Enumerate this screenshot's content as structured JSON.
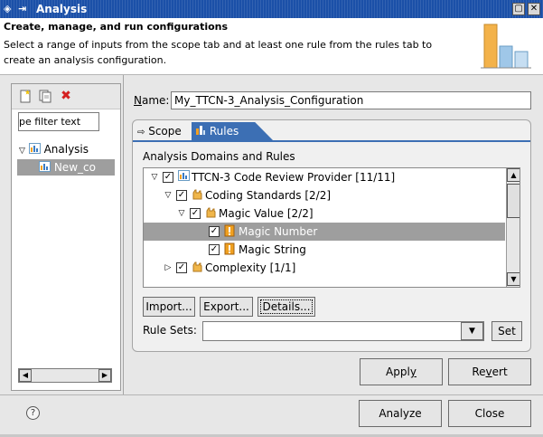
{
  "window": {
    "title": "Analysis",
    "title_arrow": "⇥",
    "title_icon": "analysis-window-icon",
    "buttons": [
      "maximize",
      "close"
    ]
  },
  "header": {
    "title": "Create, manage, and run configurations",
    "description": "Select a range of inputs from the scope tab and at least one rule from the rules tab to create an analysis configuration."
  },
  "left_panel": {
    "filter_text": "pe filter text",
    "tree": {
      "root_label": "Analysis",
      "child_label": "New_co"
    },
    "toolbar_icons": [
      "new-configuration-icon",
      "duplicate-icon",
      "delete-icon"
    ]
  },
  "name_field": {
    "label_prefix": "N",
    "label_rest": "ame:",
    "value": "My_TTCN-3_Analysis_Configuration"
  },
  "tabs": {
    "scope": "Scope",
    "rules": "Rules",
    "active": "Rules"
  },
  "rules_tab": {
    "section_label": "Analysis Domains and Rules",
    "tree_rows": [
      {
        "label": "TTCN-3 Code Review Provider [11/11]",
        "level": 0,
        "expanded": true,
        "checked": true,
        "icon": "provider-icon",
        "selected": false
      },
      {
        "label": "Coding Standards [2/2]",
        "level": 1,
        "expanded": true,
        "checked": true,
        "icon": "category-icon",
        "selected": false
      },
      {
        "label": "Magic Value [2/2]",
        "level": 2,
        "expanded": true,
        "checked": true,
        "icon": "category-icon",
        "selected": false
      },
      {
        "label": "Magic Number",
        "level": 3,
        "expanded": null,
        "checked": true,
        "icon": "rule-icon",
        "selected": true
      },
      {
        "label": "Magic String",
        "level": 3,
        "expanded": null,
        "checked": true,
        "icon": "rule-icon",
        "selected": false
      },
      {
        "label": "Complexity [1/1]",
        "level": 1,
        "expanded": false,
        "checked": true,
        "icon": "category-icon",
        "selected": false
      }
    ],
    "buttons": {
      "import": "Import...",
      "export": "Export...",
      "details": "Details..."
    },
    "rule_sets_label": "Rule Sets:",
    "rule_sets_value": "",
    "set_button": "Set"
  },
  "actions": {
    "apply_prefix": "Appl",
    "apply_mnemonic": "y",
    "apply_suffix": "",
    "revert_prefix": "Re",
    "revert_mnemonic": "v",
    "revert_suffix": "ert",
    "analyze": "Analyze",
    "close": "Close"
  },
  "help": "?"
}
